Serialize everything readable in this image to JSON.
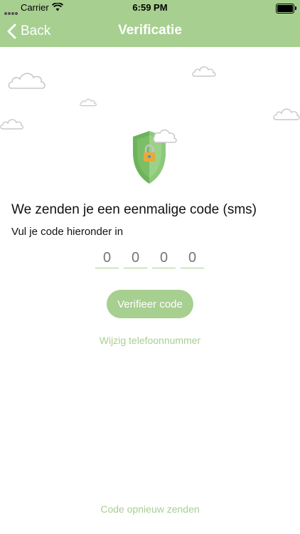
{
  "status_bar": {
    "carrier": "Carrier",
    "time": "6:59 PM"
  },
  "nav": {
    "back_label": "Back",
    "title": "Verificatie"
  },
  "content": {
    "heading": "We zenden je een eenmalige code (sms)",
    "subheading": "Vul je code hieronder in",
    "code_placeholders": [
      "0",
      "0",
      "0",
      "0"
    ],
    "verify_label": "Verifieer code",
    "change_phone_label": "Wijzig telefoonnummer",
    "resend_label": "Code opnieuw zenden"
  },
  "colors": {
    "brand": "#a7cf90",
    "shield_dark": "#6cb35a",
    "shield_light": "#8ec97b",
    "lock": "#e8a93a"
  },
  "icons": [
    "signal-icon",
    "wifi-icon",
    "battery-icon",
    "chevron-left-icon",
    "cloud-icon",
    "shield-lock-icon"
  ]
}
